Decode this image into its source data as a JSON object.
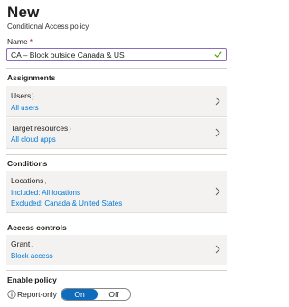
{
  "header": {
    "title": "New",
    "subtitle": "Conditional Access policy"
  },
  "name_field": {
    "label": "Name",
    "required_mark": "*",
    "value": "CA – Block outside Canada & US",
    "status_icon": "check-icon",
    "accent": "#8a6dbb"
  },
  "sections": {
    "assignments": "Assignments",
    "conditions": "Conditions",
    "access_controls": "Access controls",
    "enable_policy": "Enable policy"
  },
  "cards": {
    "users": {
      "label": "Users",
      "mark": ")",
      "value": "All users"
    },
    "target_resources": {
      "label": "Target resources",
      "mark": ")",
      "value": "All cloud apps"
    },
    "locations": {
      "label": "Locations",
      "mark": ",",
      "value1": "Included: All locations",
      "value2": "Excluded: Canada & United States"
    },
    "grant": {
      "label": "Grant",
      "mark": ",",
      "value": "Block access"
    }
  },
  "enable_policy": {
    "options": [
      "Report-only",
      "On",
      "Off"
    ],
    "selected": "On",
    "info_icon": "info-icon"
  },
  "colors": {
    "link": "#0078d4",
    "toggle_on": "#0f6cbd",
    "card_bg": "#f3f2f1"
  }
}
